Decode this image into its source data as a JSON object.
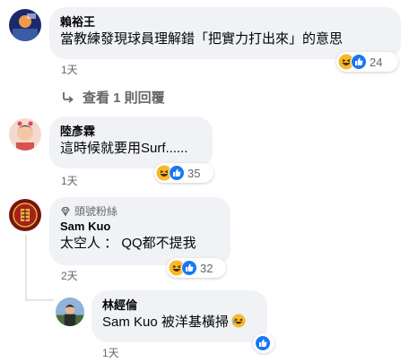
{
  "comments": [
    {
      "author": "賴裕王",
      "text": "當教練發現球員理解錯「把實力打出來」的意思",
      "time": "1天",
      "reaction_count": "24"
    },
    {
      "author": "陸彥霖",
      "text": "這時候就要用Surf......",
      "time": "1天",
      "reaction_count": "35"
    },
    {
      "badge": "頭號粉絲",
      "author": "Sam Kuo",
      "text": "太空人 ： QQ都不提我",
      "time": "2天",
      "reaction_count": "32"
    },
    {
      "author": "林經倫",
      "text": "Sam Kuo 被洋基橫掃",
      "time": "1天"
    }
  ],
  "view_replies_label": "查看 1 則回覆",
  "icons": {
    "laugh": "haha-reaction-icon",
    "like": "like-reaction-icon",
    "reply_arrow": "reply-arrow-icon",
    "fan_badge": "diamond-badge-icon"
  },
  "colors": {
    "bubble": "#f0f2f5",
    "meta": "#65676b",
    "like_blue": "#1877f2",
    "haha_yellow": "#f7b928"
  }
}
